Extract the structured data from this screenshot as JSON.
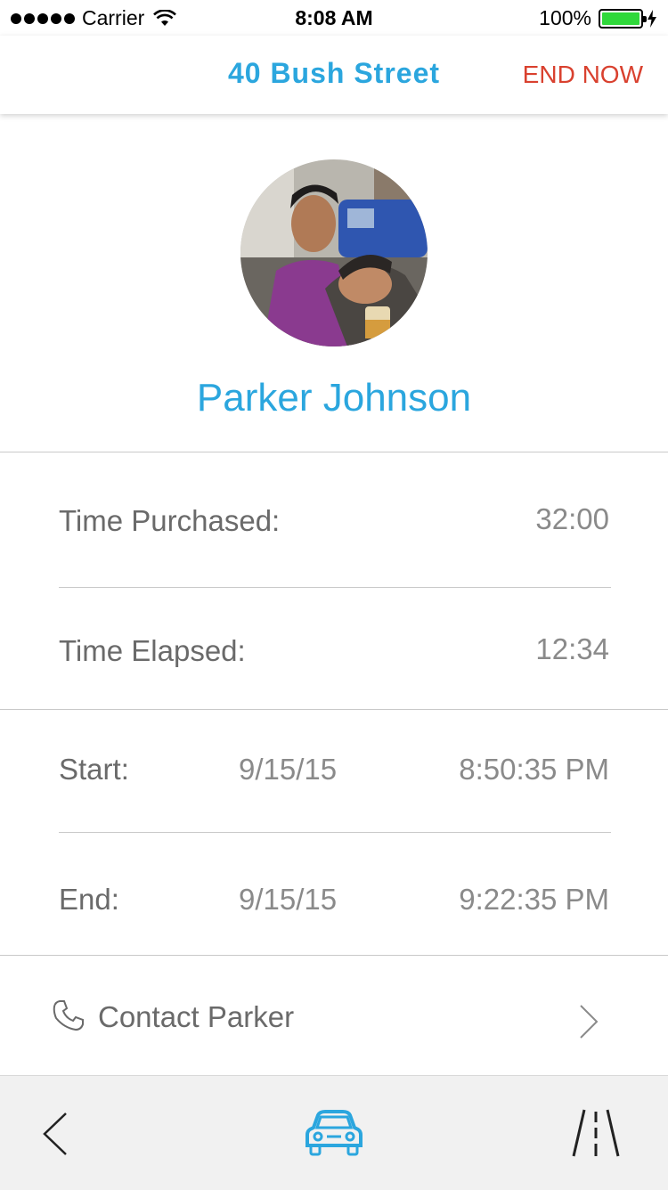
{
  "status_bar": {
    "carrier": "Carrier",
    "time": "8:08 AM",
    "battery": "100%"
  },
  "header": {
    "title": "40 Bush Street",
    "end_now": "END NOW"
  },
  "profile": {
    "name": "Parker Johnson"
  },
  "details": {
    "time_purchased_label": "Time Purchased:",
    "time_purchased_value": "32:00",
    "time_elapsed_label": "Time Elapsed:",
    "time_elapsed_value": "12:34",
    "start_label": "Start:",
    "start_date": "9/15/15",
    "start_time": "8:50:35 PM",
    "end_label": "End:",
    "end_date": "9/15/15",
    "end_time": "9:22:35 PM"
  },
  "contact": {
    "label": "Contact Parker"
  },
  "tab_bar": {
    "icons": [
      "back-chevron-icon",
      "car-icon",
      "road-icon"
    ]
  },
  "colors": {
    "accent": "#2ba6de",
    "danger": "#d9412f",
    "battery": "#2fd83a"
  }
}
